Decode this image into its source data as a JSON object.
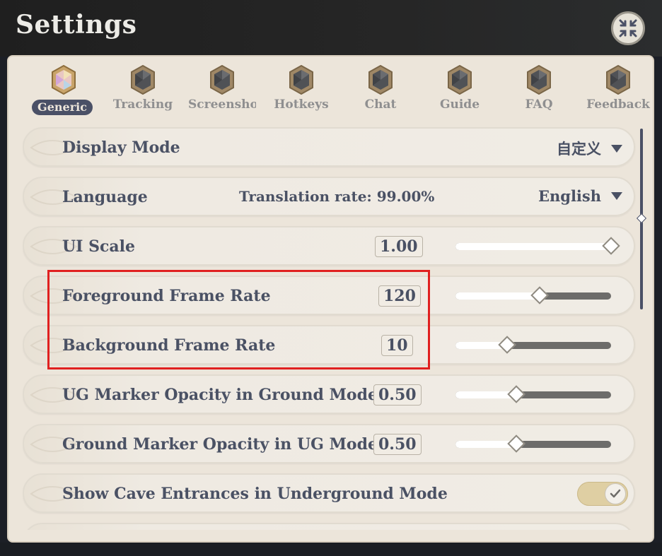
{
  "window": {
    "title": "Settings"
  },
  "tabs": [
    {
      "label": "Generic",
      "active": true
    },
    {
      "label": "Tracking",
      "active": false
    },
    {
      "label": "Screenshot",
      "active": false
    },
    {
      "label": "Hotkeys",
      "active": false
    },
    {
      "label": "Chat",
      "active": false
    },
    {
      "label": "Guide",
      "active": false
    },
    {
      "label": "FAQ",
      "active": false
    },
    {
      "label": "Feedback",
      "active": false
    }
  ],
  "settings": {
    "display_mode": {
      "label": "Display Mode",
      "value": "自定义"
    },
    "language": {
      "label": "Language",
      "translation_rate": "Translation rate: 99.00%",
      "value": "English"
    },
    "ui_scale": {
      "label": "UI Scale",
      "value": "1.00",
      "level": 1.0
    },
    "foreground_frame_rate": {
      "label": "Foreground Frame Rate",
      "value": "120",
      "level": 0.54
    },
    "background_frame_rate": {
      "label": "Background Frame Rate",
      "value": "10",
      "level": 0.33
    },
    "ug_marker_opacity": {
      "label": "UG Marker Opacity in Ground Mode",
      "value": "0.50",
      "level": 0.39
    },
    "ground_marker_opacity": {
      "label": "Ground Marker Opacity in UG Mode",
      "value": "0.50",
      "level": 0.39
    },
    "show_cave_entrances": {
      "label": "Show Cave Entrances in Underground Mode",
      "checked": true
    }
  },
  "colors": {
    "accent": "#4a5066",
    "panel_bg": "#ece5da",
    "highlight_border": "#e02020",
    "toggle_on": "#dfcfa3"
  },
  "icons": {
    "close": "collapse-arrows-icon",
    "tab": "hexagon-gem-icon",
    "dropdown": "caret-down-icon",
    "toggle": "checkmark-icon"
  }
}
